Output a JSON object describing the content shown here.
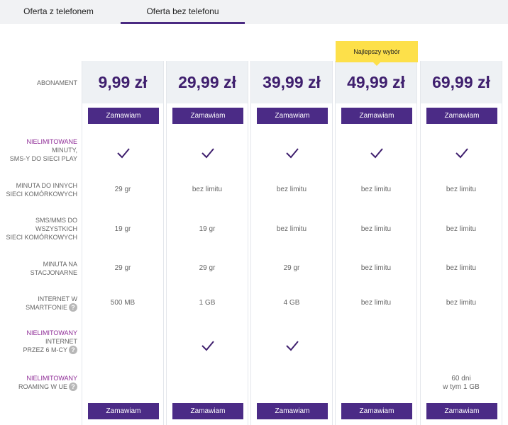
{
  "tabs": [
    {
      "label": "Oferta z telefonem",
      "active": false
    },
    {
      "label": "Oferta bez telefonu",
      "active": true
    }
  ],
  "badge": "Najlepszy wybór",
  "order_label": "Zamawiam",
  "labels": {
    "abonament": "ABONAMENT",
    "unlimited_calls": {
      "hl": "NIELIMITOWANE",
      "l2": "MINUTY,",
      "l3": "SMS-Y DO SIECI PLAY"
    },
    "minute_other": {
      "l1": "MINUTA DO INNYCH",
      "l2": "SIECI KOMÓRKOWYCH"
    },
    "sms_mms": {
      "l1": "SMS/MMS DO",
      "l2": "WSZYSTKICH",
      "l3": "SIECI KOMÓRKOWYCH"
    },
    "minute_landline": {
      "l1": "MINUTA NA",
      "l2": "STACJONARNE"
    },
    "internet": {
      "l1": "INTERNET W",
      "l2": "SMARTFONIE"
    },
    "unlimited_internet": {
      "hl": "NIELIMITOWANY",
      "l2": "INTERNET",
      "l3": "PRZEZ 6 M-CY"
    },
    "unlimited_roaming": {
      "hl": "NIELIMITOWANY",
      "l2": "ROAMING W UE"
    },
    "help_glyph": "?"
  },
  "plans": [
    {
      "price": "9,99 zł",
      "calls": "29 gr",
      "sms": "19 gr",
      "landline": "29 gr",
      "internet": "500 MB",
      "roaming": {
        "l1": "",
        "l2": ""
      }
    },
    {
      "price": "29,99 zł",
      "calls": "bez limitu",
      "sms": "19 gr",
      "landline": "29 gr",
      "internet": "1 GB",
      "roaming": {
        "l1": "",
        "l2": ""
      }
    },
    {
      "price": "39,99 zł",
      "calls": "bez limitu",
      "sms": "bez limitu",
      "landline": "29 gr",
      "internet": "4 GB",
      "roaming": {
        "l1": "",
        "l2": ""
      }
    },
    {
      "price": "49,99 zł",
      "calls": "bez limitu",
      "sms": "bez limitu",
      "landline": "bez limitu",
      "internet": "bez limitu",
      "roaming": {
        "l1": "",
        "l2": ""
      }
    },
    {
      "price": "69,99 zł",
      "calls": "bez limitu",
      "sms": "bez limitu",
      "landline": "bez limitu",
      "internet": "bez limitu",
      "roaming": {
        "l1": "60 dni",
        "l2": "w tym 1 GB"
      }
    }
  ],
  "features": {
    "unlimited_calls_included": [
      true,
      true,
      true,
      true,
      true
    ],
    "unlimited_internet_included": [
      false,
      true,
      true,
      false,
      false
    ]
  },
  "colors": {
    "brand": "#4b2b86",
    "price": "#3f1f6e",
    "highlight": "#8e2b96",
    "badge": "#fde04a"
  }
}
